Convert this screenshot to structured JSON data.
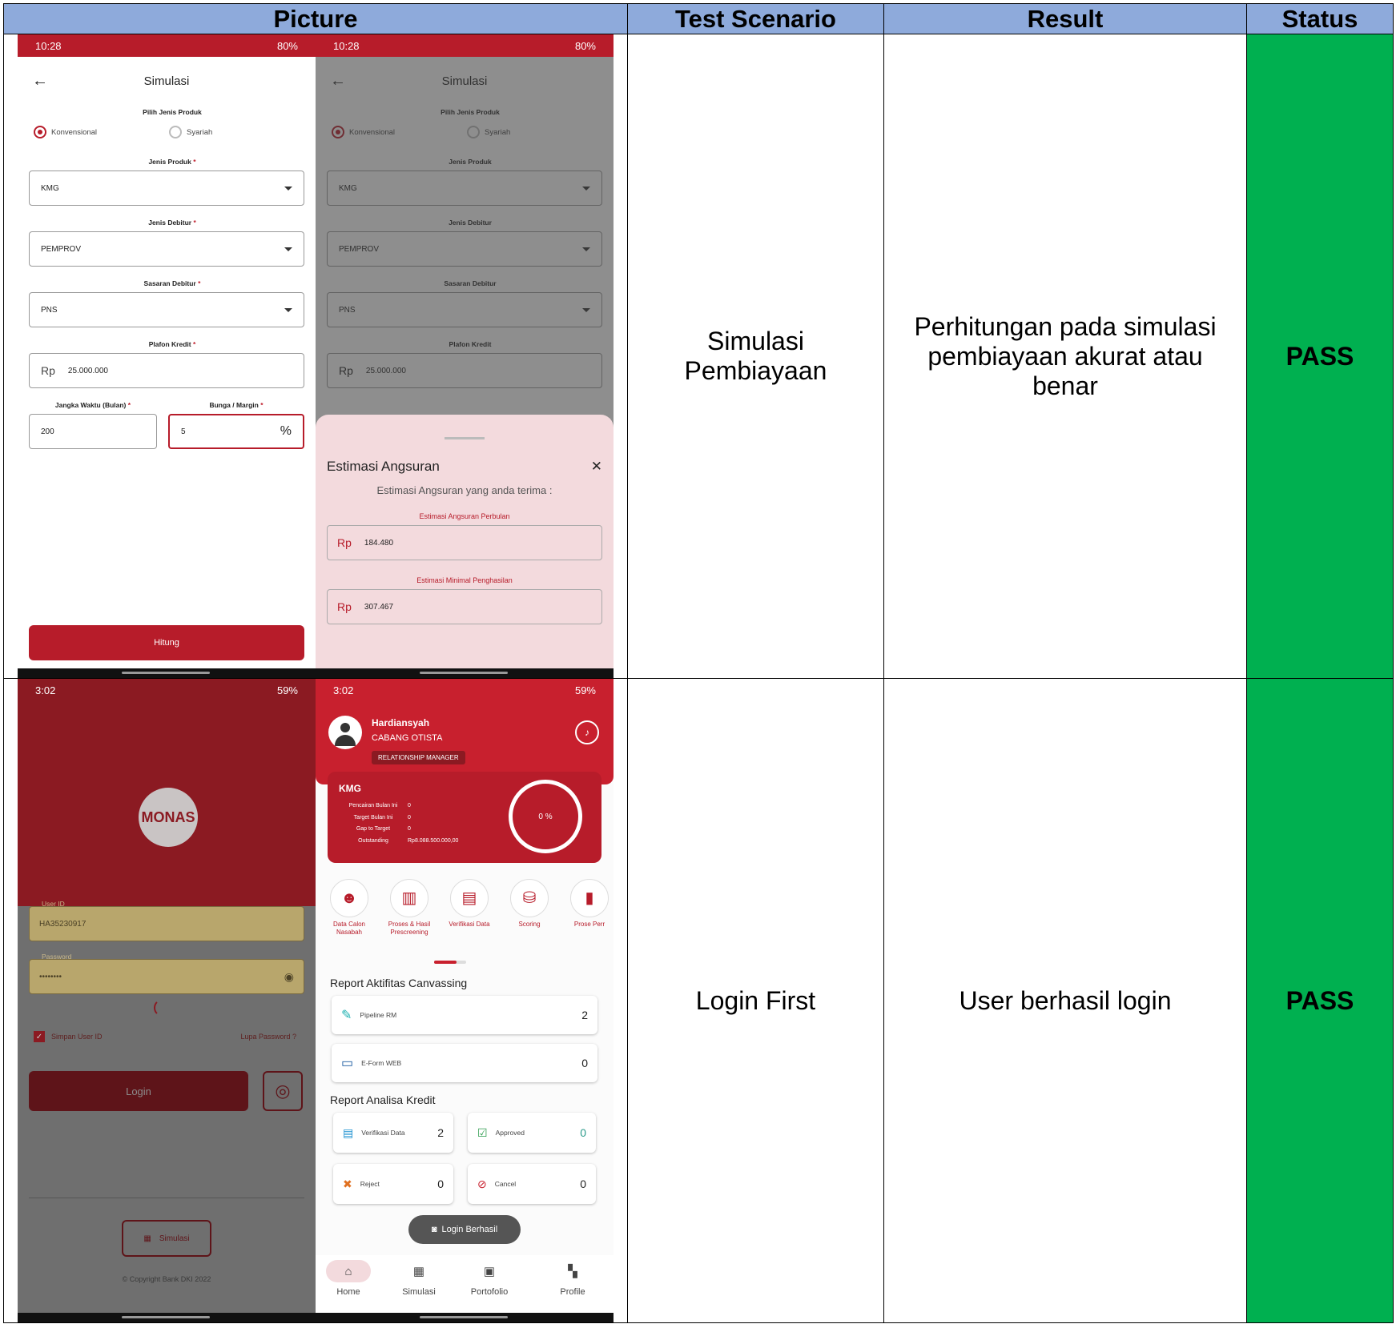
{
  "headers": {
    "picture": "Picture",
    "scenario": "Test Scenario",
    "result": "Result",
    "status": "Status"
  },
  "rows": [
    {
      "scenario": "Simulasi Pembiayaan",
      "result": "Perhitungan pada simulasi pembiayaan akurat atau benar",
      "status": "PASS",
      "left_phone": {
        "status_time": "10:28",
        "status_battery": "80%",
        "title": "Simulasi",
        "product_type_label": "Pilih Jenis Produk",
        "option_konv": "Konvensional",
        "option_syariah": "Syariah",
        "jenis_produk_label": "Jenis Produk",
        "jenis_produk_value": "KMG",
        "jenis_debitur_label": "Jenis Debitur",
        "jenis_debitur_value": "PEMPROV",
        "sasaran_label": "Sasaran Debitur",
        "sasaran_value": "PNS",
        "plafon_label": "Plafon Kredit",
        "currency": "Rp",
        "plafon_value": "25.000.000",
        "jangka_label": "Jangka Waktu (Bulan)",
        "jangka_value": "200",
        "bunga_label": "Bunga / Margin",
        "bunga_value": "5",
        "percent": "%",
        "hitung": "Hitung",
        "required": "*"
      },
      "right_phone": {
        "sheet_title": "Estimasi Angsuran",
        "sheet_desc": "Estimasi Angsuran yang anda terima :",
        "perbulan_label": "Estimasi Angsuran Perbulan",
        "perbulan_value": "184.480",
        "minimal_label": "Estimasi Minimal Penghasilan",
        "minimal_value": "307.467",
        "close": "✕"
      }
    },
    {
      "scenario": "Login First",
      "result": "User berhasil login",
      "status": "PASS",
      "left_phone": {
        "status_time": "3:02",
        "status_battery": "59%",
        "logo": "MONAS",
        "userid_label": "User ID",
        "userid_value": "HA35230917",
        "password_label": "Password",
        "password_value": "••••••••",
        "remember": "Simpan User ID",
        "forgot": "Lupa Password ?",
        "login": "Login",
        "simulasi": "Simulasi",
        "copyright": "© Copyright Bank DKI 2022"
      },
      "right_phone": {
        "name": "Hardiansyah",
        "branch": "CABANG OTISTA",
        "role": "RELATIONSHIP MANAGER",
        "kmg": "KMG",
        "stats": [
          {
            "label": "Pencairan Bulan Ini",
            "value": "0"
          },
          {
            "label": "Target Bulan Ini",
            "value": "0"
          },
          {
            "label": "Gap to Target",
            "value": "0"
          },
          {
            "label": "Outstanding",
            "value": "Rp8.088.500.000,00"
          }
        ],
        "progress": "0 %",
        "menu": [
          "Data Calon Nasabah",
          "Proses & Hasil Prescreening",
          "Verifikasi Data",
          "Scoring",
          "Prose Perr"
        ],
        "canvassing_title": "Report Aktifitas Canvassing",
        "pipeline_label": "Pipeline RM",
        "pipeline_value": "2",
        "eform_label": "E-Form WEB",
        "eform_value": "0",
        "analisa_title": "Report Analisa Kredit",
        "verifikasi_label": "Verifikasi Data",
        "verifikasi_value": "2",
        "approved_label": "Approved",
        "approved_value": "0",
        "reject_label": "Reject",
        "reject_value": "0",
        "cancel_label": "Cancel",
        "cancel_value": "0",
        "toast": "Login Berhasil",
        "nav": [
          "Home",
          "Simulasi",
          "Portofolio",
          "Profile"
        ]
      }
    }
  ],
  "colors": {
    "header_bg": "#8eaadb",
    "status_bg": "#00b050",
    "brand_red": "#b71c2a"
  }
}
